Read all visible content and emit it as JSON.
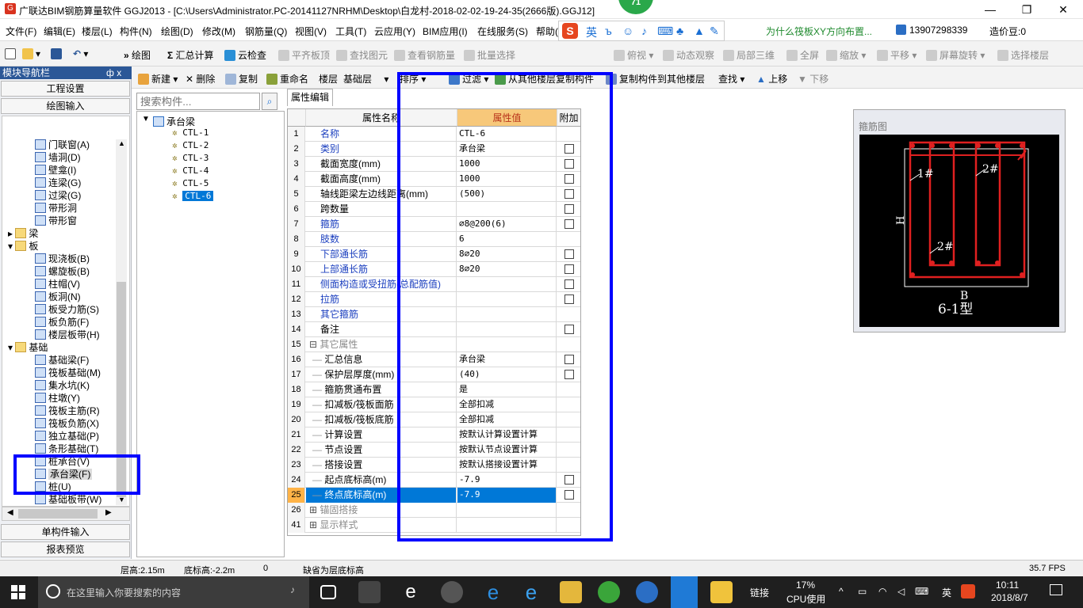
{
  "window": {
    "title": "广联达BIM钢筋算量软件 GGJ2013 - [C:\\Users\\Administrator.PC-20141127NRHM\\Desktop\\白龙村-2018-02-02-19-24-35(2666版).GGJ12]",
    "badge": "71",
    "minimize": "—",
    "restore": "❐",
    "close": "✕"
  },
  "menu": [
    "文件(F)",
    "编辑(E)",
    "楼层(L)",
    "构件(N)",
    "绘图(D)",
    "修改(M)",
    "钢筋量(Q)",
    "视图(V)",
    "工具(T)",
    "云应用(Y)",
    "BIM应用(I)",
    "在线服务(S)",
    "帮助(H)"
  ],
  "menu_right": {
    "tip": "为什么筏板XY方向布置...",
    "phone": "13907298339",
    "coins": "造价豆:0"
  },
  "ime": {
    "s": "S",
    "lang": "英",
    "sym": "ъ"
  },
  "toolbar1": [
    "绘图",
    "汇总计算",
    "云检查",
    "平齐板顶",
    "查找图元",
    "查看钢筋量",
    "批量选择",
    "二维",
    "俯视",
    "动态观察",
    "局部三维",
    "全屏",
    "缩放",
    "平移",
    "屏幕旋转",
    "选择楼层"
  ],
  "nav": {
    "header": "模块导航栏",
    "pin": "ф x",
    "btn_project": "工程设置",
    "btn_draw": "绘图输入",
    "btn_single": "单构件输入",
    "btn_report": "报表预览",
    "tree": [
      {
        "label": "门联窗(A)",
        "level": 2
      },
      {
        "label": "墙洞(D)",
        "level": 2
      },
      {
        "label": "壁龛(I)",
        "level": 2
      },
      {
        "label": "连梁(G)",
        "level": 2
      },
      {
        "label": "过梁(G)",
        "level": 2
      },
      {
        "label": "带形洞",
        "level": 2
      },
      {
        "label": "带形窗",
        "level": 2
      },
      {
        "label": "梁",
        "level": 1,
        "toggle": "+"
      },
      {
        "label": "板",
        "level": 1,
        "toggle": "-"
      },
      {
        "label": "现浇板(B)",
        "level": 2
      },
      {
        "label": "螺旋板(B)",
        "level": 2
      },
      {
        "label": "柱帽(V)",
        "level": 2
      },
      {
        "label": "板洞(N)",
        "level": 2
      },
      {
        "label": "板受力筋(S)",
        "level": 2
      },
      {
        "label": "板负筋(F)",
        "level": 2
      },
      {
        "label": "楼层板带(H)",
        "level": 2
      },
      {
        "label": "基础",
        "level": 1,
        "toggle": "-"
      },
      {
        "label": "基础梁(F)",
        "level": 2
      },
      {
        "label": "筏板基础(M)",
        "level": 2
      },
      {
        "label": "集水坑(K)",
        "level": 2
      },
      {
        "label": "柱墩(Y)",
        "level": 2
      },
      {
        "label": "筏板主筋(R)",
        "level": 2
      },
      {
        "label": "筏板负筋(X)",
        "level": 2
      },
      {
        "label": "独立基础(P)",
        "level": 2
      },
      {
        "label": "条形基础(T)",
        "level": 2
      },
      {
        "label": "桩承台(V)",
        "level": 2
      },
      {
        "label": "承台梁(F)",
        "level": 2,
        "selected": true
      },
      {
        "label": "桩(U)",
        "level": 2
      },
      {
        "label": "基础板带(W)",
        "level": 2
      }
    ]
  },
  "toolbar2": [
    "新建",
    "删除",
    "复制",
    "重命名",
    "楼层",
    "基础层",
    "排序",
    "过滤",
    "从其他楼层复制构件",
    "复制构件到其他楼层",
    "查找",
    "上移",
    "下移"
  ],
  "components": {
    "search_placeholder": "搜索构件...",
    "root": "承台梁",
    "items": [
      "CTL-1",
      "CTL-2",
      "CTL-3",
      "CTL-4",
      "CTL-5",
      "CTL-6"
    ],
    "selected": "CTL-6"
  },
  "props": {
    "tab": "属性编辑",
    "col_name": "属性名称",
    "col_value": "属性值",
    "col_extra": "附加",
    "rows": [
      {
        "n": "1",
        "name": "名称",
        "val": "CTL-6",
        "blue": true,
        "chk": false
      },
      {
        "n": "2",
        "name": "类别",
        "val": "承台梁",
        "blue": true,
        "chk": true
      },
      {
        "n": "3",
        "name": "截面宽度(mm)",
        "val": "1000",
        "chk": true
      },
      {
        "n": "4",
        "name": "截面高度(mm)",
        "val": "1000",
        "chk": true
      },
      {
        "n": "5",
        "name": "轴线距梁左边线距离(mm)",
        "val": "(500)",
        "chk": true
      },
      {
        "n": "6",
        "name": "跨数量",
        "val": "",
        "chk": true
      },
      {
        "n": "7",
        "name": "箍筋",
        "val": "⌀8@200(6)",
        "blue": true,
        "chk": true
      },
      {
        "n": "8",
        "name": "肢数",
        "val": "6",
        "blue": true,
        "chk": false
      },
      {
        "n": "9",
        "name": "下部通长筋",
        "val": "8⌀20",
        "blue": true,
        "chk": true
      },
      {
        "n": "10",
        "name": "上部通长筋",
        "val": "8⌀20",
        "blue": true,
        "chk": true
      },
      {
        "n": "11",
        "name": "侧面构造或受扭筋(总配筋值)",
        "val": "",
        "blue": true,
        "chk": true
      },
      {
        "n": "12",
        "name": "拉筋",
        "val": "",
        "blue": true,
        "chk": true
      },
      {
        "n": "13",
        "name": "其它箍筋",
        "val": "",
        "blue": true,
        "chk": false
      },
      {
        "n": "14",
        "name": "备注",
        "val": "",
        "chk": true
      },
      {
        "n": "15",
        "name": "其它属性",
        "val": "",
        "gray": true,
        "toggle": "-",
        "chk": false
      },
      {
        "n": "16",
        "name": "汇总信息",
        "val": "承台梁",
        "indent": true,
        "chk": true
      },
      {
        "n": "17",
        "name": "保护层厚度(mm)",
        "val": "(40)",
        "indent": true,
        "chk": true
      },
      {
        "n": "18",
        "name": "箍筋贯通布置",
        "val": "是",
        "indent": true,
        "chk": false
      },
      {
        "n": "19",
        "name": "扣减板/筏板面筋",
        "val": "全部扣减",
        "indent": true,
        "chk": false
      },
      {
        "n": "20",
        "name": "扣减板/筏板底筋",
        "val": "全部扣减",
        "indent": true,
        "chk": false
      },
      {
        "n": "21",
        "name": "计算设置",
        "val": "按默认计算设置计算",
        "indent": true,
        "chk": false
      },
      {
        "n": "22",
        "name": "节点设置",
        "val": "按默认节点设置计算",
        "indent": true,
        "chk": false
      },
      {
        "n": "23",
        "name": "搭接设置",
        "val": "按默认搭接设置计算",
        "indent": true,
        "chk": false
      },
      {
        "n": "24",
        "name": "起点底标高(m)",
        "val": "-7.9",
        "indent": true,
        "chk": true
      },
      {
        "n": "25",
        "name": "终点底标高(m)",
        "val": "-7.9",
        "indent": true,
        "chk": true,
        "selected": true
      },
      {
        "n": "26",
        "name": "锚固搭接",
        "val": "",
        "gray": true,
        "toggle": "+",
        "chk": false
      },
      {
        "n": "41",
        "name": "显示样式",
        "val": "",
        "gray": true,
        "toggle": "+",
        "chk": false
      }
    ]
  },
  "stirrup": {
    "title": "箍筋图",
    "label1": "1#",
    "label2a": "2#",
    "label2b": "2#",
    "h": "H",
    "b": "B",
    "type": "6-1型"
  },
  "status": {
    "floor_height": "层高:2.15m",
    "bottom_elev": "底标高:-2.2m",
    "zero": "0",
    "hint": "缺省为层底标高",
    "fps": "35.7 FPS"
  },
  "taskbar": {
    "search": "在这里输入你要搜索的内容",
    "link": "链接",
    "cpu": "17%",
    "cpu_label": "CPU使用",
    "lang": "英",
    "time": "10:11",
    "date": "2018/8/7"
  },
  "colors": {
    "accent": "#0000ff",
    "selection": "#0078d7",
    "header_hl": "#f7c87a",
    "nav_header": "#2b5797",
    "rebar": "#e02020"
  }
}
